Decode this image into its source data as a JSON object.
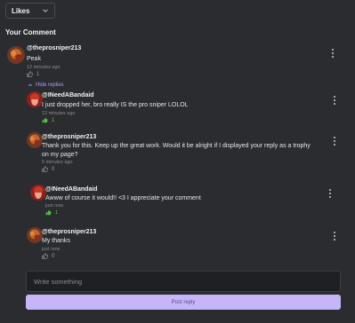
{
  "sort": {
    "selected": "Likes"
  },
  "section_title": "Your Comment",
  "hide_replies_label": "Hide replies",
  "comments": [
    {
      "author": "@theprosniper213",
      "text": "Peak",
      "time": "12 minutes ago",
      "likes": "1",
      "liked": false
    },
    {
      "author": "@INeedABandaid",
      "text": "I just dropped her, bro really IS the pro sniper LOLOL",
      "time": "12 minutes ago",
      "likes": "1",
      "liked": true
    },
    {
      "author": "@theprosniper213",
      "text": "Thank you for this. Keep up the great work. Would it be alright if I displayed your reply as a trophy on my page?",
      "time": "5 minutes ago",
      "likes": "0",
      "liked": false
    },
    {
      "author": "@INeedABandaid",
      "text": "Awww of course it would!! <3 I appreciate your comment",
      "time": "just now",
      "likes": "1",
      "liked": true
    },
    {
      "author": "@theprosniper213",
      "text": "My thanks",
      "time": "just now",
      "likes": "0",
      "liked": false
    }
  ],
  "reply": {
    "placeholder": "Write something",
    "post_label": "Post reply"
  }
}
